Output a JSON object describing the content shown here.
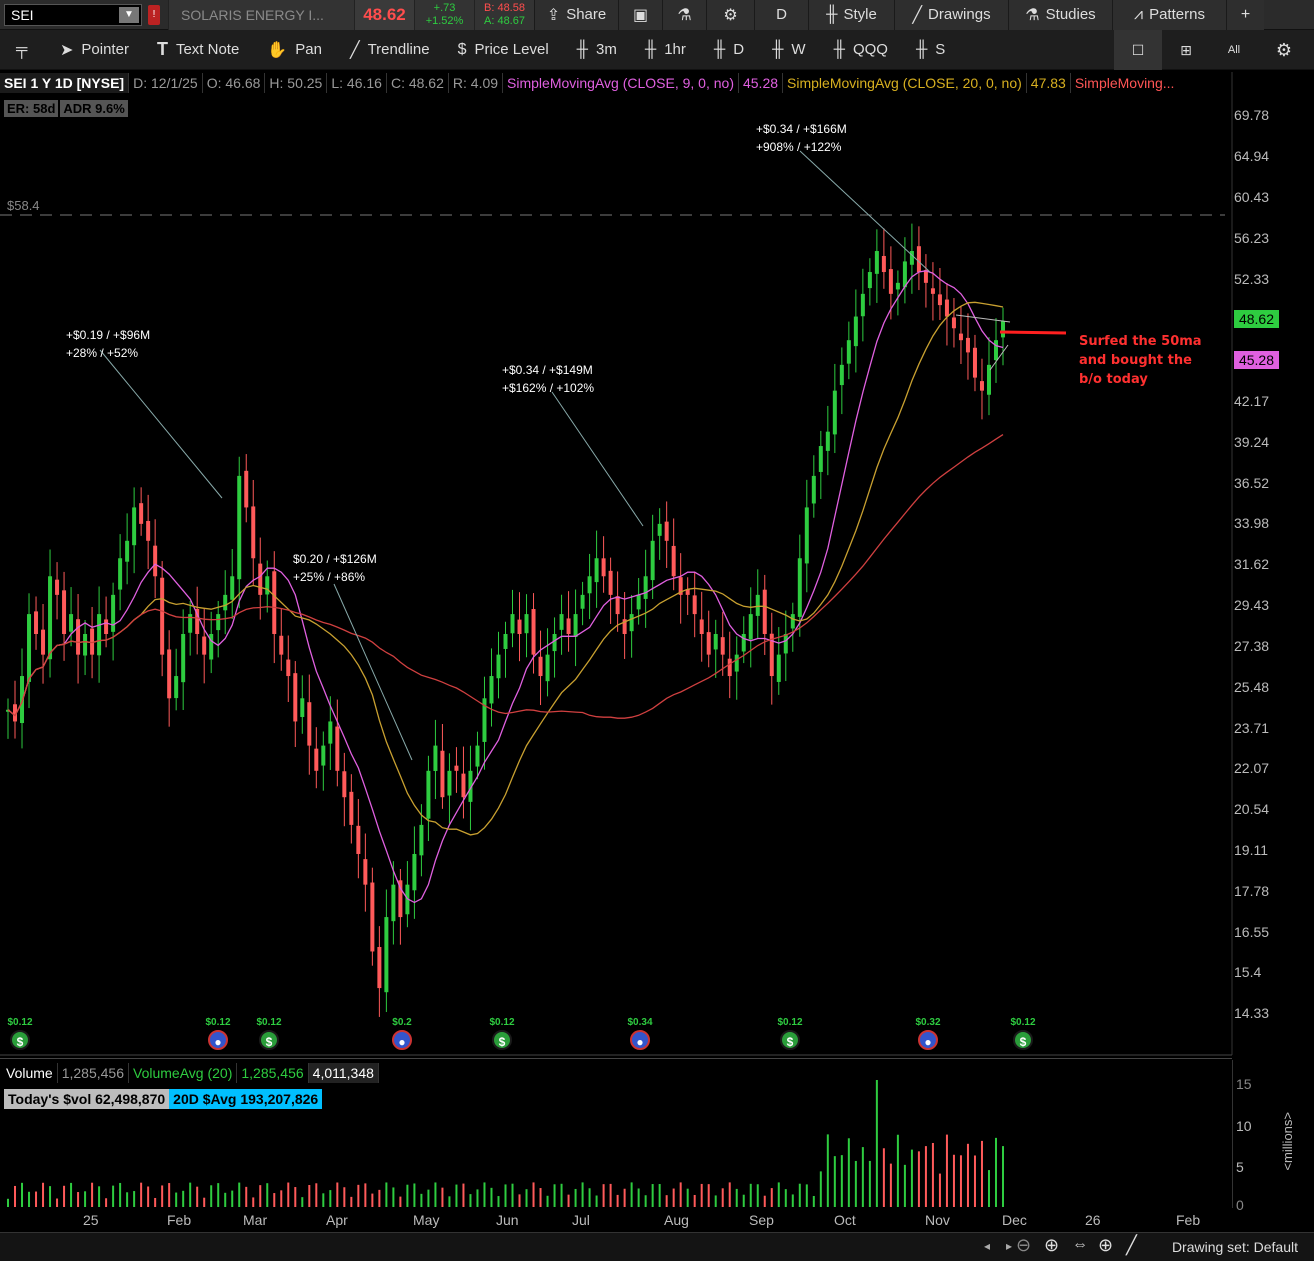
{
  "header": {
    "symbol": "SEI",
    "alert": "!",
    "company": "SOLARIS ENERGY I...",
    "last": "48.62",
    "change": "+.73",
    "change_pct": "+1.52%",
    "bid": "B: 48.58",
    "ask": "A: 48.67",
    "share": "Share",
    "period": "D",
    "style": "Style",
    "drawings": "Drawings",
    "studies": "Studies",
    "patterns": "Patterns"
  },
  "tools": {
    "pointer": "Pointer",
    "textnote": "Text Note",
    "pan": "Pan",
    "trendline": "Trendline",
    "pricelevel": "Price Level",
    "t3m": "3m",
    "t1hr": "1hr",
    "td": "D",
    "tw": "W",
    "tqqq": "QQQ",
    "ts": "S",
    "all": "All"
  },
  "study": {
    "sym": "SEI 1 Y 1D [NYSE]",
    "d": "D: 12/1/25",
    "o": "O: 46.68",
    "h": "H: 50.25",
    "l": "L: 46.16",
    "c": "C: 48.62",
    "r": "R: 4.09",
    "ma9": "SimpleMovingAvg (CLOSE, 9, 0, no)",
    "ma9v": "45.28",
    "ma20": "SimpleMovingAvg (CLOSE, 20, 0, no)",
    "ma20v": "47.83",
    "ma50": "SimpleMoving..."
  },
  "badges": {
    "er": "ER: 58d",
    "adr": "ADR 9.6%"
  },
  "level_label": "$58.4",
  "price_axis": [
    "69.78",
    "64.94",
    "60.43",
    "56.23",
    "52.33",
    "48.62",
    "45.28",
    "42.17",
    "39.24",
    "36.52",
    "33.98",
    "31.62",
    "29.43",
    "27.38",
    "25.48",
    "23.71",
    "22.07",
    "20.54",
    "19.11",
    "17.78",
    "16.55",
    "15.4",
    "14.33"
  ],
  "tags": {
    "last": "48.62",
    "ma9": "45.28"
  },
  "annotations": {
    "a1l1": "+$0.19 / +$96M",
    "a1l2": "+28% / +52%",
    "a2l1": "$0.20 / +$126M",
    "a2l2": "+25% / +86%",
    "a3l1": "+$0.34 / +$149M",
    "a3l2": "+$162% / +102%",
    "a4l1": "+$0.34 / +$166M",
    "a4l2": "+908% / +122%",
    "note1": "Surfed the 50ma",
    "note2": "and bought the",
    "note3": "b/o today"
  },
  "dividends": [
    {
      "label": "$0.12",
      "type": "dol"
    },
    {
      "label": "$0.12",
      "type": "ern"
    },
    {
      "label": "$0.12",
      "type": "dol"
    },
    {
      "label": "$0.2",
      "type": "ern"
    },
    {
      "label": "$0.12",
      "type": "dol"
    },
    {
      "label": "$0.34",
      "type": "ern"
    },
    {
      "label": "$0.12",
      "type": "dol"
    },
    {
      "label": "$0.32",
      "type": "ern"
    },
    {
      "label": "$0.12",
      "type": "dol"
    }
  ],
  "volume": {
    "label": "Volume",
    "value": "1,285,456",
    "avg_label": "VolumeAvg (20)",
    "avg_value": "1,285,456",
    "avg2": "4,011,348",
    "today": "Today's $vol 62,498,870",
    "avg20": "20D $Avg 193,207,826",
    "axis": [
      "15",
      "10",
      "5",
      "0"
    ],
    "unit": "<millions>"
  },
  "xaxis": [
    "25",
    "Feb",
    "Mar",
    "Apr",
    "May",
    "Jun",
    "Jul",
    "Aug",
    "Sep",
    "Oct",
    "Nov",
    "Dec",
    "26",
    "Feb"
  ],
  "footer": {
    "drawing_set": "Drawing set: Default"
  },
  "colors": {
    "up": "#2ecc40",
    "down": "#ff5a5a",
    "ma9": "#e060e0",
    "ma20": "#c8a030",
    "ma50": "#d04040"
  },
  "chart_data": {
    "type": "candlestick",
    "symbol": "SEI",
    "period": "1 Y 1D",
    "ylim": [
      14.33,
      69.78
    ],
    "y_scale": "log",
    "level": 58.4,
    "closes": [
      24.5,
      24.0,
      26,
      29,
      28,
      27,
      31,
      30,
      28,
      29,
      27,
      28,
      27,
      29,
      28,
      30,
      32,
      33,
      35,
      34,
      33,
      31,
      27,
      25,
      26,
      28,
      29,
      28,
      27,
      28,
      29,
      30,
      31,
      37,
      35,
      32,
      30,
      31,
      28,
      27,
      26,
      24,
      25,
      23,
      22,
      23,
      24,
      22,
      21,
      20,
      19,
      18,
      16,
      15,
      17,
      18,
      17,
      18,
      19,
      20,
      22,
      23,
      21,
      22,
      22,
      21,
      22,
      23,
      25,
      26,
      27,
      28,
      29,
      28,
      29,
      27,
      26,
      27,
      28,
      29,
      28,
      29,
      30,
      31,
      32,
      31,
      30,
      29,
      28,
      29,
      30,
      31,
      33,
      34,
      33,
      31,
      30,
      30,
      29,
      28,
      27,
      28,
      27,
      26,
      27,
      28,
      29,
      30,
      28,
      26,
      27,
      28,
      29,
      32,
      35,
      37,
      39,
      40,
      43,
      45,
      47,
      49,
      51,
      53,
      55,
      53,
      51,
      52,
      54,
      55,
      53,
      52,
      51,
      50,
      49,
      48,
      47,
      46,
      44,
      43,
      45,
      47,
      48.62
    ]
  }
}
